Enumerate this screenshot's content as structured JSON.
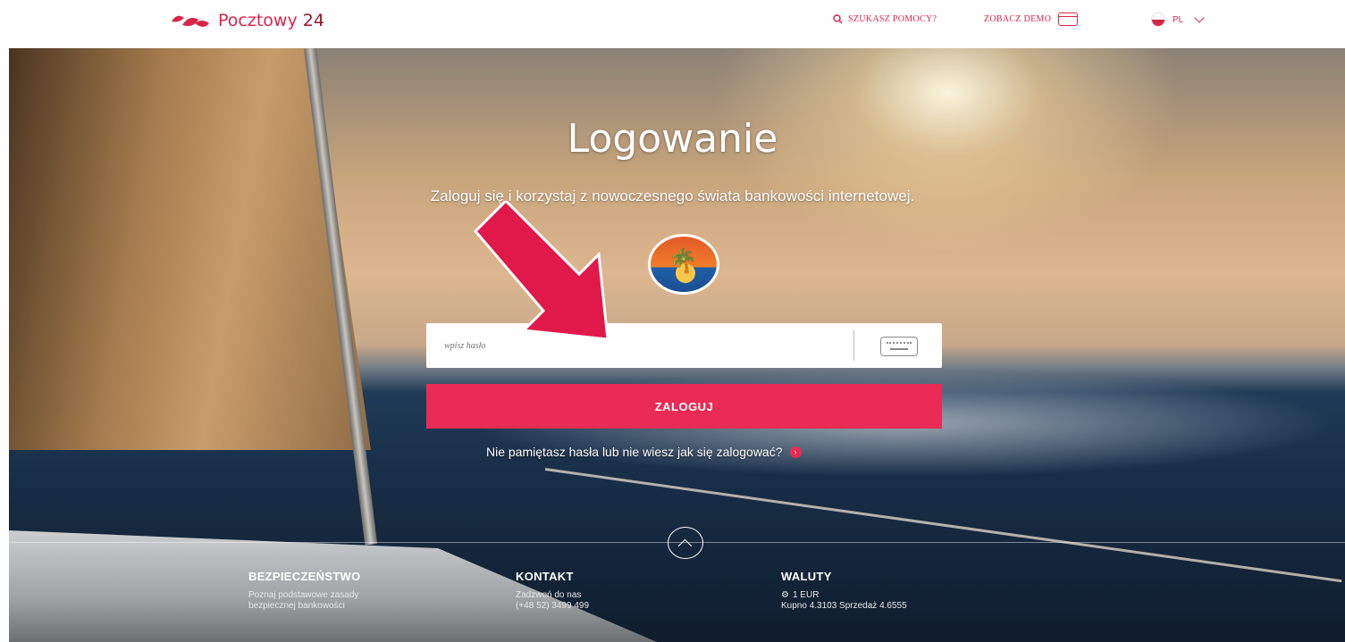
{
  "header": {
    "logo_text": "Pocztowy",
    "logo_number": "24",
    "help_label": "SZUKASZ POMOCY?",
    "demo_label": "ZOBACZ DEMO",
    "language": "PL"
  },
  "hero": {
    "title": "Logowanie",
    "subtitle": "Zaloguj się i korzystaj z nowoczesnego świata bankowości internetowej."
  },
  "login": {
    "password_placeholder": "wpisz hasło",
    "password_value": "",
    "submit_label": "ZALOGUJ",
    "forgot_text": "Nie pamiętasz hasła lub nie wiesz jak się zalogować?"
  },
  "footer": {
    "security_title": "BEZPIECZEŃSTWO",
    "security_line1": "Poznaj podstawowe zasady",
    "security_line2": "bezpiecznej bankowości",
    "contact_title": "KONTAKT",
    "contact_line1": "Zadzwoń do nas",
    "contact_line2": "(+48 52) 3499 499",
    "currency_title": "WALUTY",
    "currency_unit": "1 EUR",
    "currency_rates": "Kupno 4.3103 Sprzedaż 4.6555"
  },
  "colors": {
    "brand": "#d9254a",
    "button": "#ea2b55",
    "annotation_arrow": "#e0194a"
  }
}
